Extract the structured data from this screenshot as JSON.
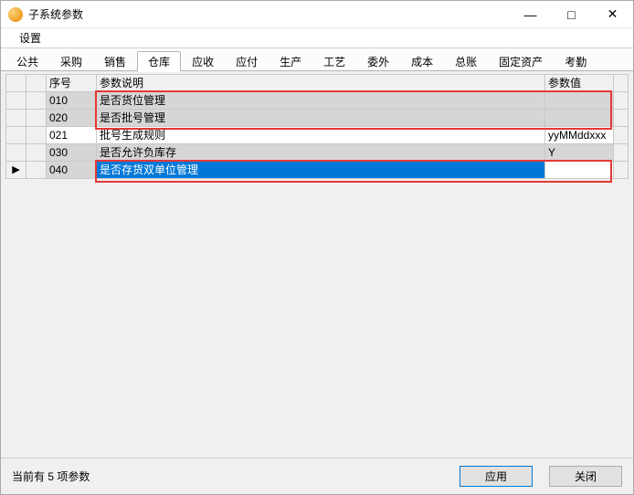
{
  "window": {
    "title": "子系统参数"
  },
  "menubar": {
    "settings": "设置"
  },
  "tabs": [
    {
      "id": "gg",
      "label": "公共"
    },
    {
      "id": "cg",
      "label": "采购"
    },
    {
      "id": "xs",
      "label": "销售"
    },
    {
      "id": "ck",
      "label": "仓库",
      "active": true
    },
    {
      "id": "ys",
      "label": "应收"
    },
    {
      "id": "yf",
      "label": "应付"
    },
    {
      "id": "sc",
      "label": "生产"
    },
    {
      "id": "gy",
      "label": "工艺"
    },
    {
      "id": "ww",
      "label": "委外"
    },
    {
      "id": "cb",
      "label": "成本"
    },
    {
      "id": "zz",
      "label": "总账"
    },
    {
      "id": "gdzc",
      "label": "固定资产"
    },
    {
      "id": "kq",
      "label": "考勤"
    }
  ],
  "columns": {
    "seq": "序号",
    "desc": "参数说明",
    "val": "参数值"
  },
  "rows": [
    {
      "seq": "010",
      "desc": "是否货位管理",
      "val": "",
      "shade": "gray"
    },
    {
      "seq": "020",
      "desc": "是否批号管理",
      "val": "",
      "shade": "gray"
    },
    {
      "seq": "021",
      "desc": "批号生成规则",
      "val": "yyMMddxxx",
      "shade": "white"
    },
    {
      "seq": "030",
      "desc": "是否允许负库存",
      "val": "Y",
      "shade": "gray"
    },
    {
      "seq": "040",
      "desc": "是否存货双单位管理",
      "val": "",
      "shade": "gray",
      "selected": true,
      "marker": "▶"
    }
  ],
  "footer": {
    "status_prefix": "当前有 ",
    "status_count": "5",
    "status_suffix": " 项参数",
    "apply": "应用",
    "close": "关闭"
  }
}
